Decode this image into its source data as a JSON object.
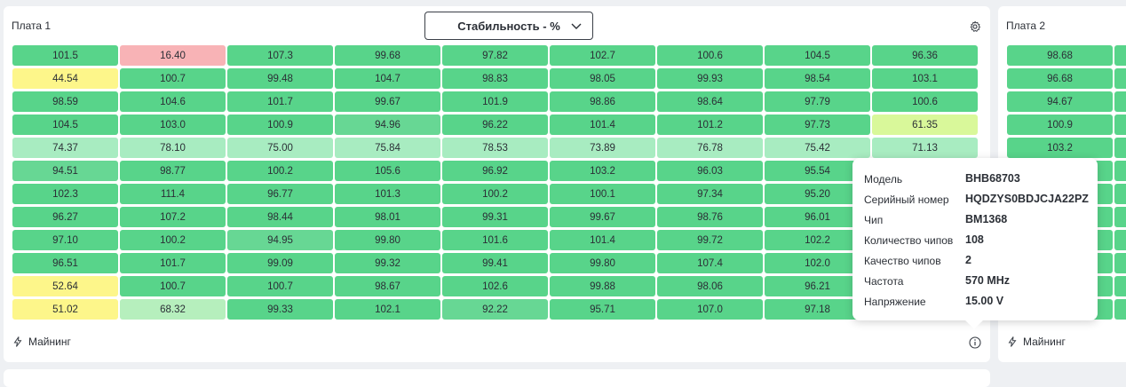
{
  "board1": {
    "title": "Плата 1",
    "metric_select": "Стабильность - %",
    "footer_label": "Майнинг",
    "rows": [
      [
        [
          "101.5",
          "g"
        ],
        [
          "16.40",
          "r"
        ],
        [
          "107.3",
          "g"
        ],
        [
          "99.68",
          "g"
        ],
        [
          "97.82",
          "g"
        ],
        [
          "102.7",
          "g"
        ],
        [
          "100.6",
          "g"
        ],
        [
          "104.5",
          "g"
        ],
        [
          "96.36",
          "g"
        ]
      ],
      [
        [
          "44.54",
          "y"
        ],
        [
          "100.7",
          "g"
        ],
        [
          "99.48",
          "g"
        ],
        [
          "104.7",
          "g"
        ],
        [
          "98.83",
          "g"
        ],
        [
          "98.05",
          "g"
        ],
        [
          "99.93",
          "g"
        ],
        [
          "98.54",
          "g"
        ],
        [
          "103.1",
          "g"
        ]
      ],
      [
        [
          "98.59",
          "g"
        ],
        [
          "104.6",
          "g"
        ],
        [
          "101.7",
          "g"
        ],
        [
          "99.67",
          "g"
        ],
        [
          "101.9",
          "g"
        ],
        [
          "98.86",
          "g"
        ],
        [
          "98.64",
          "g"
        ],
        [
          "97.79",
          "g"
        ],
        [
          "100.6",
          "g"
        ]
      ],
      [
        [
          "104.5",
          "g"
        ],
        [
          "103.0",
          "g"
        ],
        [
          "100.9",
          "g"
        ],
        [
          "94.96",
          "g2"
        ],
        [
          "96.22",
          "g"
        ],
        [
          "101.4",
          "g"
        ],
        [
          "101.2",
          "g"
        ],
        [
          "97.73",
          "g"
        ],
        [
          "61.35",
          "lm"
        ]
      ],
      [
        [
          "74.37",
          "lg"
        ],
        [
          "78.10",
          "lg"
        ],
        [
          "75.00",
          "lg"
        ],
        [
          "75.84",
          "lg"
        ],
        [
          "78.53",
          "lg"
        ],
        [
          "73.89",
          "lg"
        ],
        [
          "76.78",
          "lg"
        ],
        [
          "75.42",
          "lg"
        ],
        [
          "71.13",
          "lg"
        ]
      ],
      [
        [
          "94.51",
          "g2"
        ],
        [
          "98.77",
          "g"
        ],
        [
          "100.2",
          "g"
        ],
        [
          "105.6",
          "g"
        ],
        [
          "96.92",
          "g"
        ],
        [
          "103.2",
          "g"
        ],
        [
          "96.03",
          "g"
        ],
        [
          "95.54",
          "g"
        ],
        [
          "",
          "g"
        ]
      ],
      [
        [
          "102.3",
          "g"
        ],
        [
          "111.4",
          "g"
        ],
        [
          "96.77",
          "g"
        ],
        [
          "101.3",
          "g"
        ],
        [
          "100.2",
          "g"
        ],
        [
          "100.1",
          "g"
        ],
        [
          "97.34",
          "g"
        ],
        [
          "95.20",
          "g"
        ],
        [
          "",
          "g"
        ]
      ],
      [
        [
          "96.27",
          "g"
        ],
        [
          "107.2",
          "g"
        ],
        [
          "98.44",
          "g"
        ],
        [
          "98.01",
          "g"
        ],
        [
          "99.31",
          "g"
        ],
        [
          "99.67",
          "g"
        ],
        [
          "98.76",
          "g"
        ],
        [
          "96.01",
          "g"
        ],
        [
          "",
          "g"
        ]
      ],
      [
        [
          "97.10",
          "g"
        ],
        [
          "100.2",
          "g"
        ],
        [
          "94.95",
          "g2"
        ],
        [
          "99.80",
          "g"
        ],
        [
          "101.6",
          "g"
        ],
        [
          "101.4",
          "g"
        ],
        [
          "99.72",
          "g"
        ],
        [
          "102.2",
          "g"
        ],
        [
          "",
          "g"
        ]
      ],
      [
        [
          "96.51",
          "g"
        ],
        [
          "101.7",
          "g"
        ],
        [
          "99.09",
          "g"
        ],
        [
          "99.32",
          "g"
        ],
        [
          "99.41",
          "g"
        ],
        [
          "99.80",
          "g"
        ],
        [
          "107.4",
          "g"
        ],
        [
          "102.0",
          "g"
        ],
        [
          "",
          "g"
        ]
      ],
      [
        [
          "52.64",
          "y"
        ],
        [
          "100.7",
          "g"
        ],
        [
          "100.7",
          "g"
        ],
        [
          "98.67",
          "g"
        ],
        [
          "102.6",
          "g"
        ],
        [
          "99.88",
          "g"
        ],
        [
          "98.06",
          "g"
        ],
        [
          "96.21",
          "g"
        ],
        [
          "",
          "g"
        ]
      ],
      [
        [
          "51.02",
          "y"
        ],
        [
          "68.32",
          "pl"
        ],
        [
          "99.33",
          "g"
        ],
        [
          "102.1",
          "g"
        ],
        [
          "92.22",
          "g2"
        ],
        [
          "95.71",
          "g"
        ],
        [
          "107.0",
          "g"
        ],
        [
          "97.18",
          "g"
        ],
        [
          "",
          "g"
        ]
      ]
    ]
  },
  "board2": {
    "title": "Плата 2",
    "footer_label": "Майнинг",
    "cells": [
      "98.68",
      "96.68",
      "94.67",
      "100.9",
      "103.2",
      "",
      "",
      "",
      "",
      "",
      "",
      ""
    ]
  },
  "tooltip": {
    "rows": [
      {
        "label": "Модель",
        "value": "BHB68703"
      },
      {
        "label": "Серийный номер",
        "value": "HQDZYS0BDJCJA22PZ"
      },
      {
        "label": "Чип",
        "value": "BM1368"
      },
      {
        "label": "Количество чипов",
        "value": "108"
      },
      {
        "label": "Качество чипов",
        "value": "2"
      },
      {
        "label": "Частота",
        "value": "570 MHz"
      },
      {
        "label": "Напряжение",
        "value": "15.00 V"
      }
    ]
  }
}
